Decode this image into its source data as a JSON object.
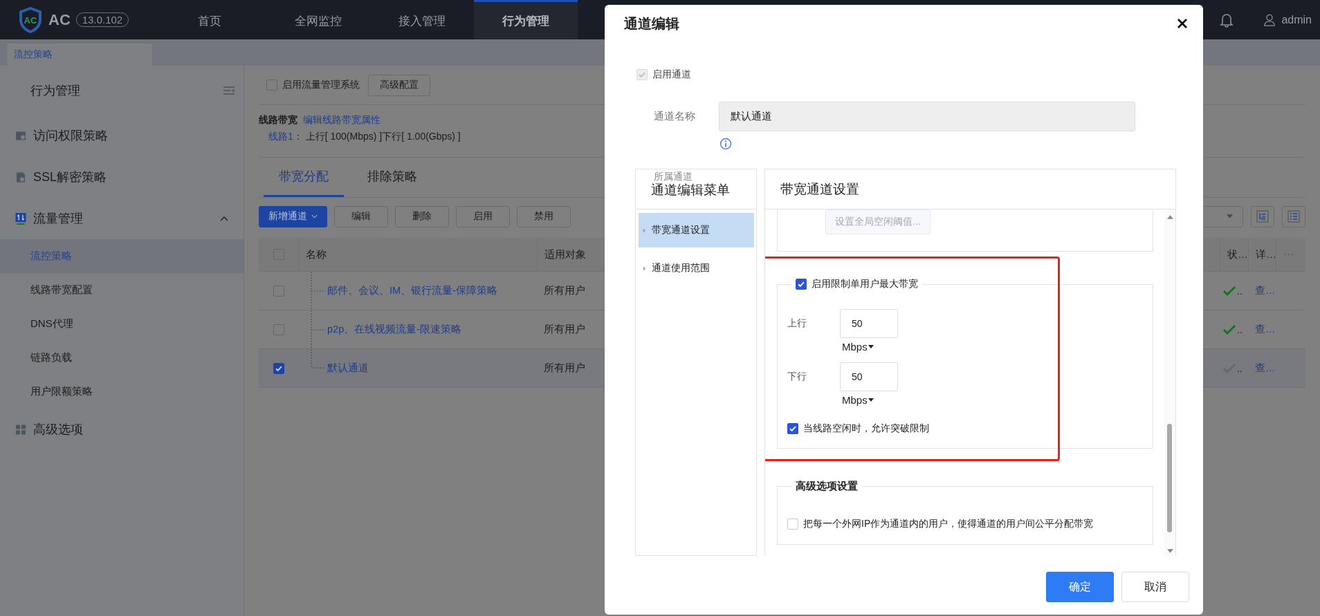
{
  "top_nav": {
    "logo_badge": "AC",
    "product": "AC",
    "version": "13.0.102",
    "items": [
      {
        "label": "首页",
        "selected": false
      },
      {
        "label": "全网监控",
        "selected": false
      },
      {
        "label": "接入管理",
        "selected": false
      },
      {
        "label": "行为管理",
        "selected": true
      }
    ],
    "user": "admin"
  },
  "page_tabs": [
    {
      "label": "流控策略",
      "selected": true
    }
  ],
  "sidebar": {
    "title": "行为管理",
    "items": [
      {
        "label": "访问权限策略",
        "selected": false
      },
      {
        "label": "SSL解密策略",
        "selected": false
      },
      {
        "label": "流量管理",
        "selected": false,
        "expanded": true,
        "children": [
          {
            "label": "流控策略",
            "selected": true
          },
          {
            "label": "线路带宽配置",
            "selected": false
          },
          {
            "label": "DNS代理",
            "selected": false
          },
          {
            "label": "链路负载",
            "selected": false
          },
          {
            "label": "用户限额策略",
            "selected": false
          }
        ]
      },
      {
        "label": "高级选项",
        "selected": false
      }
    ]
  },
  "main": {
    "traffic_system": {
      "label": "启用流量管理系统",
      "checked": false
    },
    "advanced_button": "高级配置",
    "line_bandwidth": {
      "title": "线路带宽",
      "edit_link": "编辑线路带宽属性",
      "lines": [
        {
          "name": "线路1",
          "detail": "： 上行[ 100(Mbps) ]下行[ 1.00(Gbps) ]"
        }
      ]
    },
    "tabs": [
      {
        "label": "带宽分配",
        "selected": true
      },
      {
        "label": "排除策略",
        "selected": false
      }
    ],
    "toolbar": [
      {
        "label": "新增通道",
        "kind": "dropdown"
      },
      {
        "label": "编辑",
        "kind": "plain"
      },
      {
        "label": "删除",
        "kind": "plain"
      },
      {
        "label": "启用",
        "kind": "plain"
      },
      {
        "label": "禁用",
        "kind": "plain"
      }
    ],
    "table": {
      "all_checked": false,
      "columns": [
        {
          "label": "名称"
        },
        {
          "label": "适用对象"
        },
        {
          "label": "状…"
        },
        {
          "label": "详…"
        },
        {
          "label": "⋯"
        }
      ],
      "rows": [
        {
          "checked": false,
          "name": "邮件、会议、IM、银行流量-保障策略",
          "target": "所有用户",
          "enabled": true,
          "status": "..",
          "detail": "查…"
        },
        {
          "checked": false,
          "name": "p2p、在线视频流量-限速策略",
          "target": "所有用户",
          "enabled": true,
          "status": "..",
          "detail": "查…"
        },
        {
          "checked": true,
          "name": "默认通道",
          "target": "所有用户",
          "enabled": false,
          "status": "..",
          "detail": "查…"
        }
      ]
    }
  },
  "dialog": {
    "title": "通道编辑",
    "enable_channel": {
      "label": "启用通道",
      "checked": true,
      "disabled": true
    },
    "name_field": {
      "label": "通道名称",
      "value": "默认通道",
      "disabled": true
    },
    "parent_label": "所属通道",
    "menu": {
      "title": "通道编辑菜单",
      "items": [
        {
          "label": "带宽通道设置",
          "selected": true
        },
        {
          "label": "通道使用范围",
          "selected": false
        }
      ]
    },
    "settings": {
      "title": "带宽通道设置",
      "idle_button": {
        "label": "设置全局空闲阈值...",
        "disabled": true
      },
      "per_user_limit": {
        "label": "启用限制单用户最大带宽",
        "checked": true,
        "highlighted": true,
        "fields": [
          {
            "label": "上行",
            "value": "50",
            "unit": "Mbps"
          },
          {
            "label": "下行",
            "value": "50",
            "unit": "Mbps"
          }
        ],
        "burst": {
          "label": "当线路空闲时，允许突破限制",
          "checked": true
        }
      },
      "advanced": {
        "title": "高级选项设置",
        "options": [
          {
            "label": "把每一个外网IP作为通道内的用户，使得通道的用户间公平分配带宽",
            "checked": false
          }
        ]
      }
    },
    "buttons": [
      {
        "label": "确定",
        "kind": "primary"
      },
      {
        "label": "取消",
        "kind": "default"
      }
    ]
  }
}
